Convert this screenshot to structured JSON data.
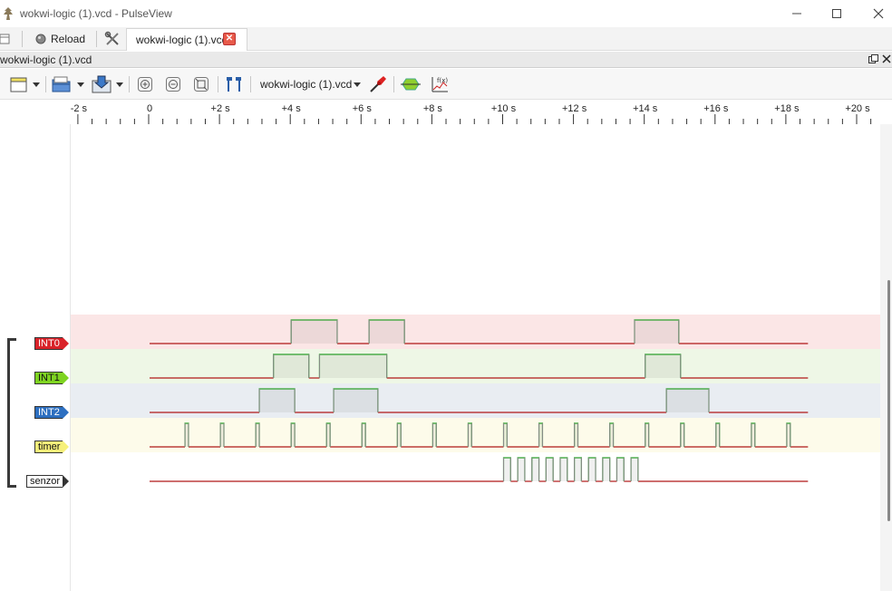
{
  "window": {
    "title": "wokwi-logic (1).vcd - PulseView",
    "controls": [
      "minimize",
      "maximize",
      "close"
    ]
  },
  "tabbar": {
    "reload_label": "Reload",
    "active_tab_label": "wokwi-logic (1).vcd"
  },
  "session": {
    "header_label": "wokwi-logic (1).vcd"
  },
  "toolbar": {
    "device_label": "wokwi-logic (1).vcd"
  },
  "ruler": {
    "ticks": [
      "-2 s",
      "0",
      "+2 s",
      "+4 s",
      "+6 s",
      "+8 s",
      "+10 s",
      "+12 s",
      "+14 s",
      "+16 s",
      "+18 s",
      "+20 s"
    ]
  },
  "colors": {
    "int0": "#d9232a",
    "int1": "#7ed321",
    "int2": "#2d6fc0",
    "timer": "#f6f07a",
    "senzor": "#ffffff",
    "low_line": "#b01818",
    "high_line": "#2ca02c"
  },
  "channels": [
    {
      "name": "INT0",
      "bg": "#fbe6e6",
      "label_bg": "#d9232a",
      "label_color": "#ffffff",
      "pulses": [
        [
          4.0,
          5.3
        ],
        [
          6.2,
          7.2
        ],
        [
          13.7,
          14.95
        ]
      ]
    },
    {
      "name": "INT1",
      "bg": "#eef7e6",
      "label_bg": "#7ed321",
      "label_color": "#111111",
      "pulses": [
        [
          3.5,
          4.5
        ],
        [
          4.8,
          6.7
        ],
        [
          14.0,
          15.0
        ]
      ]
    },
    {
      "name": "INT2",
      "bg": "#e9edf2",
      "label_bg": "#2d6fc0",
      "label_color": "#ffffff",
      "pulses": [
        [
          3.1,
          4.1
        ],
        [
          5.2,
          6.45
        ],
        [
          14.6,
          15.8
        ]
      ]
    },
    {
      "name": "timer",
      "bg": "#fdfbea",
      "label_bg": "#f6f07a",
      "label_color": "#111111",
      "pulses": [
        [
          1.0,
          1.1
        ],
        [
          2.0,
          2.1
        ],
        [
          3.0,
          3.1
        ],
        [
          4.0,
          4.1
        ],
        [
          5.0,
          5.1
        ],
        [
          6.0,
          6.1
        ],
        [
          7.0,
          7.1
        ],
        [
          8.0,
          8.1
        ],
        [
          9.0,
          9.1
        ],
        [
          10.0,
          10.1
        ],
        [
          11.0,
          11.1
        ],
        [
          12.0,
          12.1
        ],
        [
          13.0,
          13.1
        ],
        [
          14.0,
          14.1
        ],
        [
          15.0,
          15.1
        ],
        [
          16.0,
          16.1
        ],
        [
          17.0,
          17.1
        ],
        [
          18.0,
          18.1
        ]
      ]
    },
    {
      "name": "senzor",
      "bg": "#ffffff",
      "label_bg": "#ffffff",
      "label_color": "#111111",
      "pulses": [
        [
          10.0,
          10.2
        ],
        [
          10.4,
          10.6
        ],
        [
          10.8,
          11.0
        ],
        [
          11.2,
          11.4
        ],
        [
          11.6,
          11.8
        ],
        [
          12.0,
          12.2
        ],
        [
          12.4,
          12.6
        ],
        [
          12.8,
          13.0
        ],
        [
          13.2,
          13.4
        ],
        [
          13.6,
          13.8
        ]
      ]
    }
  ],
  "time_range": {
    "start": 0,
    "end": 18.6
  }
}
